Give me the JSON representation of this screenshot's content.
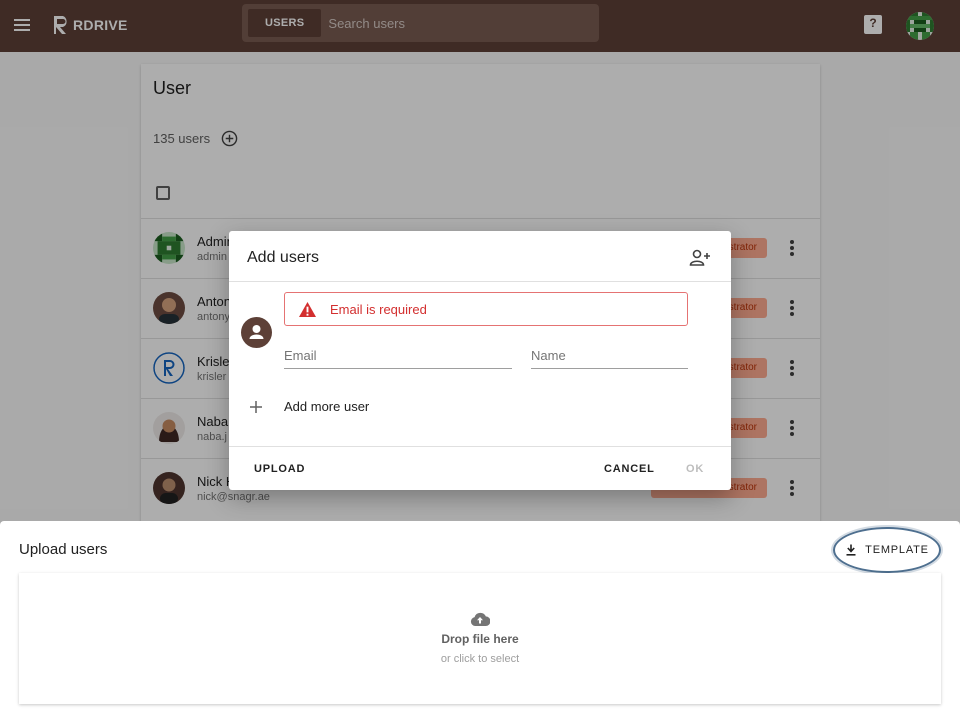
{
  "appbar": {
    "brand": "RDRIVE",
    "search_scope": "USERS",
    "search_placeholder": "Search users",
    "help_label": "?",
    "bg_color": "#5d4037"
  },
  "page": {
    "title": "User",
    "user_count": "135 users",
    "users": [
      {
        "name": "Admin",
        "email": "admin",
        "role": "Administrator",
        "avatar": "pixel-avatar-icon"
      },
      {
        "name": "Antony",
        "email": "antony",
        "role": "Administrator",
        "avatar": "photo-avatar"
      },
      {
        "name": "Krisler",
        "email": "krisler",
        "role": "Administrator",
        "avatar": "r-logo-avatar"
      },
      {
        "name": "Naba",
        "email": "naba.j",
        "role": "Administrator",
        "avatar": "photo-avatar"
      },
      {
        "name": "Nick H",
        "email": "nick@snagr.ae",
        "role": "Administrator",
        "avatar": "photo-avatar"
      }
    ]
  },
  "dialog": {
    "title": "Add users",
    "error": "Email is required",
    "email_placeholder": "Email",
    "name_placeholder": "Name",
    "add_more": "Add more user",
    "upload": "UPLOAD",
    "cancel": "CANCEL",
    "ok": "OK"
  },
  "upload_sheet": {
    "title": "Upload users",
    "template_button": "TEMPLATE",
    "drop_title": "Drop file here",
    "drop_hint": "or click to select"
  },
  "colors": {
    "accent_brown": "#5d4037",
    "error_red": "#d32f2f",
    "badge_bg": "#ffab91",
    "highlight_ring": "#4e6f8f"
  }
}
